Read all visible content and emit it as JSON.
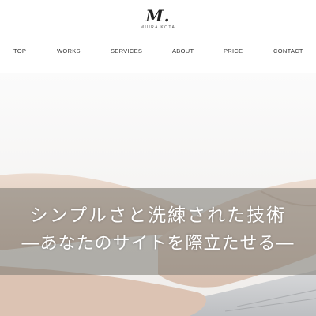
{
  "brand": {
    "logo_mark": "M.",
    "logo_sub": "MIURA KOTA"
  },
  "nav": {
    "items": [
      {
        "label": "TOP"
      },
      {
        "label": "WORKS"
      },
      {
        "label": "SERVICES"
      },
      {
        "label": "ABOUT"
      },
      {
        "label": "PRICE"
      },
      {
        "label": "CONTACT"
      }
    ]
  },
  "hero": {
    "headline": "シンプルさと洗練された技術",
    "subheadline": "―あなたのサイトを際立たせる―"
  },
  "colors": {
    "overlay": "#78766f",
    "text_on_overlay": "#ffffff",
    "nav_text": "#333333"
  }
}
